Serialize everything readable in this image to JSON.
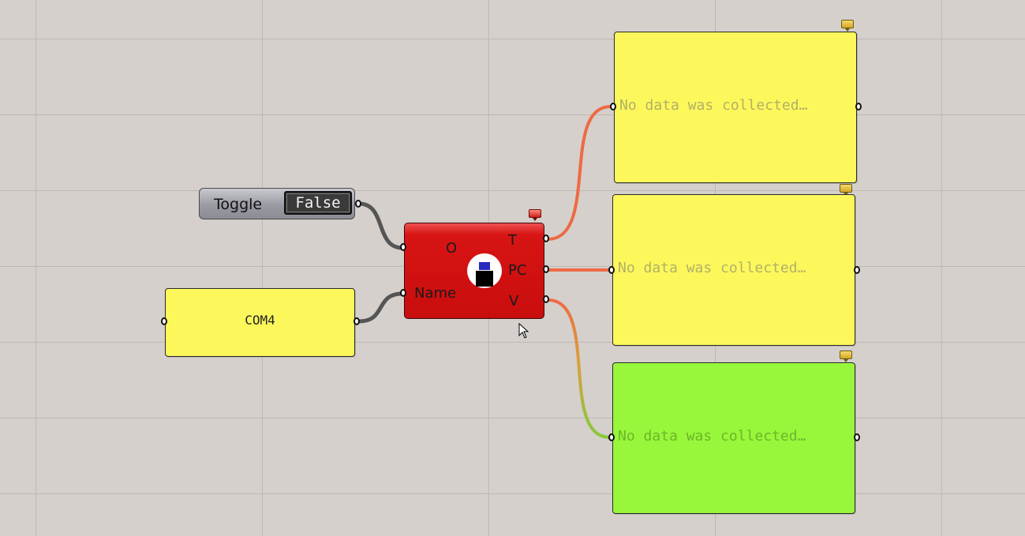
{
  "toggle": {
    "label": "Toggle",
    "value": "False"
  },
  "com_panel": {
    "text": "COM4"
  },
  "component": {
    "inputs": [
      "O",
      "Name"
    ],
    "outputs": [
      "T",
      "PC",
      "V"
    ]
  },
  "panels": [
    {
      "text": "No data was collected…",
      "color": "yellow"
    },
    {
      "text": "No data was collected…",
      "color": "yellow"
    },
    {
      "text": "No data was collected…",
      "color": "green"
    }
  ],
  "colors": {
    "canvas": "#d5d0cb",
    "panel_yellow": "#fcf85c",
    "panel_green": "#98f73a",
    "component_red": "#d81414",
    "wire_active": "#ee6a44",
    "wire_default": "#555555"
  }
}
